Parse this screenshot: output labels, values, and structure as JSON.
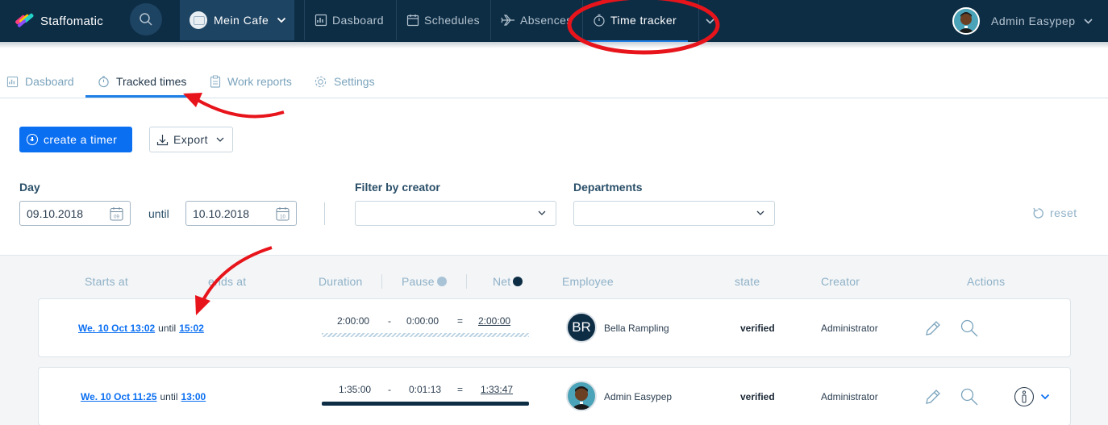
{
  "app": {
    "name": "Staffomatic"
  },
  "topnav": {
    "workspace": "Mein Cafe",
    "items": [
      {
        "label": "Dasboard",
        "icon": "dashboard-icon"
      },
      {
        "label": "Schedules",
        "icon": "calendar-icon"
      },
      {
        "label": "Absences",
        "icon": "plane-icon"
      },
      {
        "label": "Time tracker",
        "icon": "stopwatch-icon",
        "active": true
      }
    ],
    "user_name": "Admin Easypep"
  },
  "subtabs": [
    {
      "label": "Dasboard",
      "icon": "dashboard-icon"
    },
    {
      "label": "Tracked times",
      "icon": "stopwatch-icon",
      "active": true
    },
    {
      "label": "Work reports",
      "icon": "clipboard-icon"
    },
    {
      "label": "Settings",
      "icon": "gear-icon"
    }
  ],
  "toolbar": {
    "create_label": "create a timer",
    "export_label": "Export"
  },
  "filters": {
    "day_label": "Day",
    "from_date": "09.10.2018",
    "until_label": "until",
    "to_date": "10.10.2018",
    "creator_label": "Filter by creator",
    "creator_value": "",
    "departments_label": "Departments",
    "departments_value": "",
    "reset_label": "reset"
  },
  "table": {
    "headers": {
      "starts": "Starts at",
      "ends": "ends at",
      "duration": "Duration",
      "pause": "Pause",
      "net": "Net",
      "employee": "Employee",
      "state": "state",
      "creator": "Creator",
      "actions": "Actions"
    },
    "rows": [
      {
        "start": "We. 10 Oct 13:02",
        "until": "until",
        "end": "15:02",
        "duration": "2:00:00",
        "minus": "-",
        "pause": "0:00:00",
        "equals": "=",
        "net": "2:00:00",
        "employee_initials": "BR",
        "employee": "Bella Rampling",
        "state": "verified",
        "creator": "Administrator"
      },
      {
        "start": "We. 10 Oct 11:25",
        "until": "until",
        "end": "13:00",
        "duration": "1:35:00",
        "minus": "-",
        "pause": "0:01:13",
        "equals": "=",
        "net": "1:33:47",
        "employee": "Admin Easypep",
        "state": "verified",
        "creator": "Administrator"
      }
    ]
  },
  "colors": {
    "navbar": "#0d2d45",
    "accent": "#0b6ff2",
    "annotation": "#e8141b"
  }
}
